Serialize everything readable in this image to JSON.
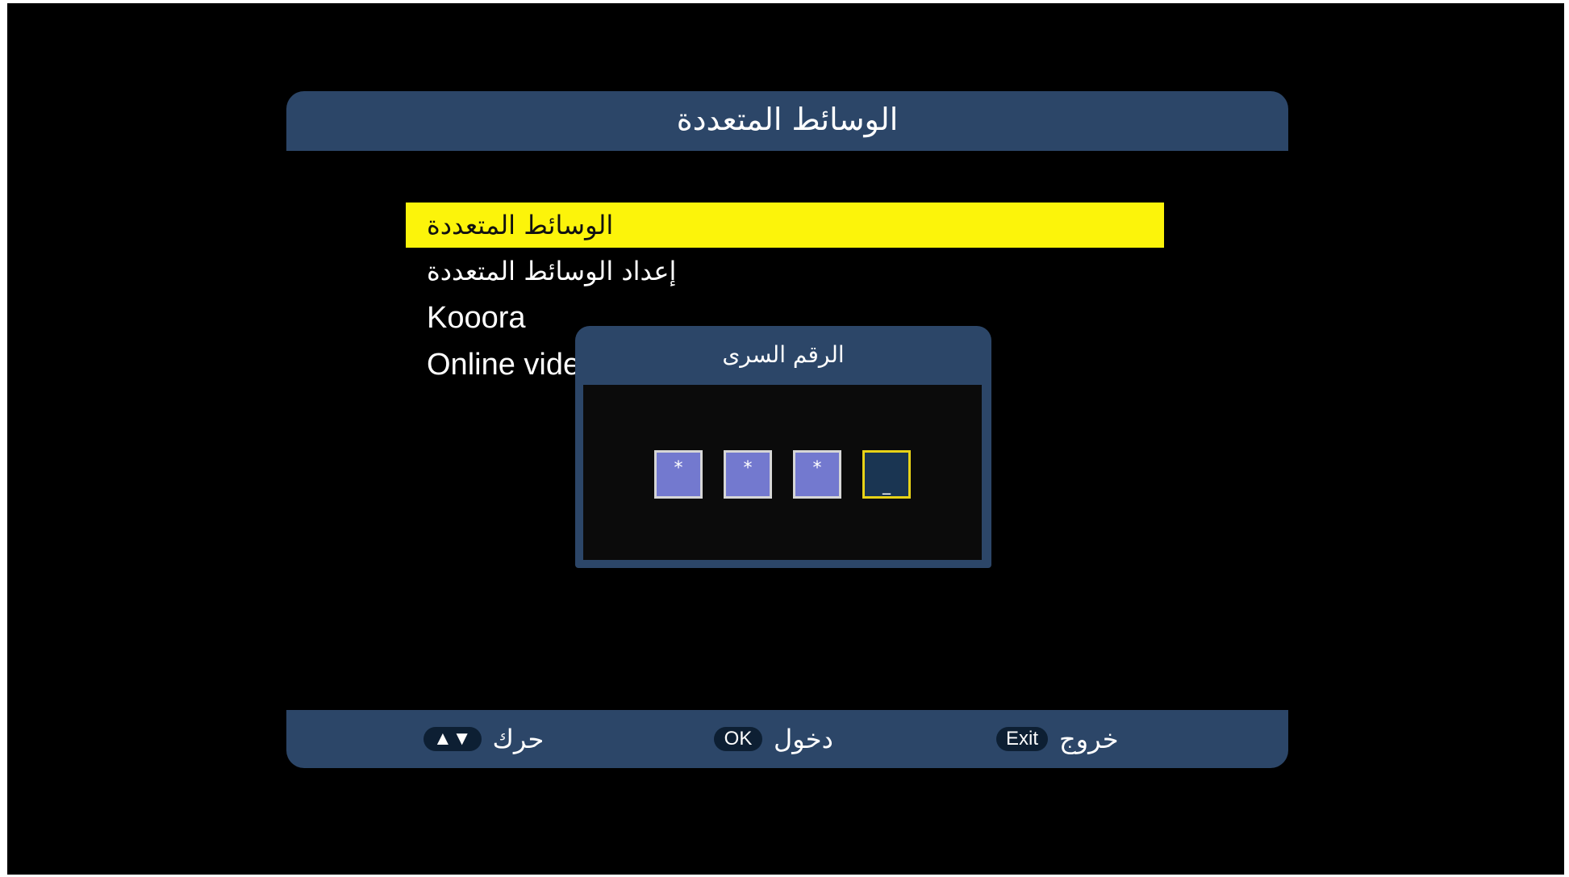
{
  "header": {
    "title": "الوسائط المتعددة"
  },
  "menu": {
    "items": [
      {
        "label": "الوسائط المتعددة",
        "selected": true
      },
      {
        "label": "إعداد الوسائط المتعددة",
        "selected": false
      },
      {
        "label": "Kooora",
        "selected": false
      },
      {
        "label": "Online vide",
        "selected": false
      }
    ]
  },
  "pin_dialog": {
    "title": "الرقم السرى",
    "digits": [
      "*",
      "*",
      "*",
      "_"
    ],
    "active_index": 3
  },
  "footer": {
    "move": {
      "key": "▲▼",
      "label": "حرك"
    },
    "ok": {
      "key": "OK",
      "label": "دخول"
    },
    "exit": {
      "key": "Exit",
      "label": "خروج"
    }
  },
  "colors": {
    "panel": "#2c4668",
    "highlight": "#fcf40a",
    "pin_box": "#7379cf",
    "pin_active_border": "#e7d217"
  }
}
